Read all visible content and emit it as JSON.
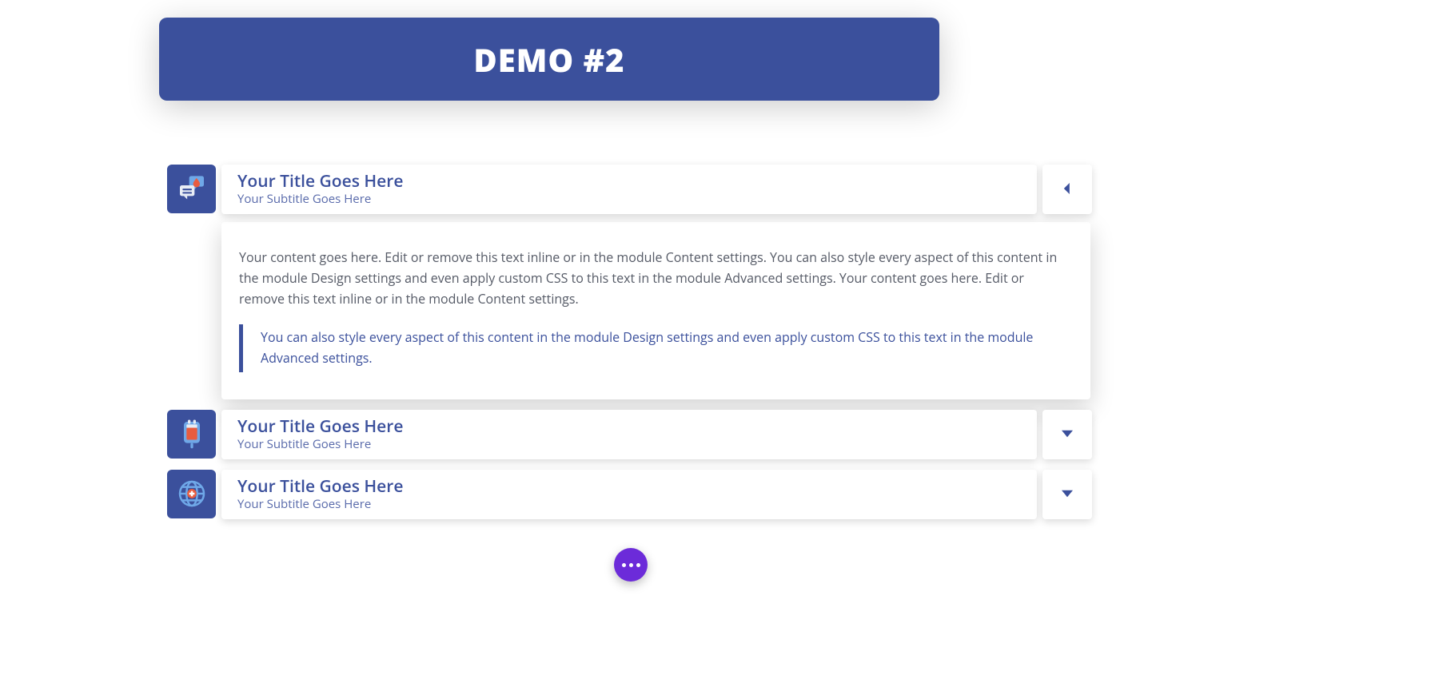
{
  "banner": {
    "title": "DEMO #2"
  },
  "accordion": {
    "items": [
      {
        "icon": "chat-blood-icon",
        "title": "Your Title Goes Here",
        "subtitle": "Your Subtitle Goes Here",
        "expanded": true,
        "content": {
          "paragraph": "Your content goes here. Edit or remove this text inline or in the module Content settings. You can also style every aspect of this content in the module Design settings and even apply custom CSS to this text in the module Advanced settings. Your content goes here. Edit or remove this text inline or in the module Content settings.",
          "blockquote": "You can also style every aspect of this content in the module Design settings and even apply custom CSS to this text in the module Advanced settings."
        }
      },
      {
        "icon": "blood-bag-icon",
        "title": "Your Title Goes Here",
        "subtitle": "Your Subtitle Goes Here",
        "expanded": false
      },
      {
        "icon": "globe-medical-icon",
        "title": "Your Title Goes Here",
        "subtitle": "Your Subtitle Goes Here",
        "expanded": false
      }
    ]
  },
  "fab": {
    "label": "more-actions"
  }
}
